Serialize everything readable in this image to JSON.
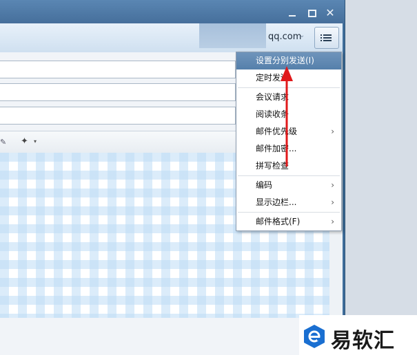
{
  "header": {
    "account": "qq.com",
    "account_caret": "⌄"
  },
  "window_controls": {
    "close": "✕"
  },
  "dropdown_menu": {
    "items": [
      {
        "label": "设置分别发送(I)",
        "selected": true,
        "submenu": false
      },
      {
        "label": "定时发送",
        "selected": false,
        "submenu": false
      },
      {
        "label": "会议请求",
        "selected": false,
        "submenu": false
      },
      {
        "label": "阅读收条",
        "selected": false,
        "submenu": false
      },
      {
        "label": "邮件优先级",
        "selected": false,
        "submenu": true
      },
      {
        "label": "邮件加密...",
        "selected": false,
        "submenu": false
      },
      {
        "label": "拼写检查",
        "selected": false,
        "submenu": false
      },
      {
        "label": "编码",
        "selected": false,
        "submenu": true
      },
      {
        "label": "显示边栏...",
        "selected": false,
        "submenu": true
      },
      {
        "label": "邮件格式(F)",
        "selected": false,
        "submenu": true
      }
    ],
    "submenu_arrow": "›",
    "selected_color": "#5f88b3"
  },
  "toolbar": {
    "caret": "▾"
  },
  "watermark": {
    "brand": "易软汇",
    "brand_color": "#1a6fd1"
  },
  "annotation": {
    "arrow_color": "#e0191b"
  }
}
